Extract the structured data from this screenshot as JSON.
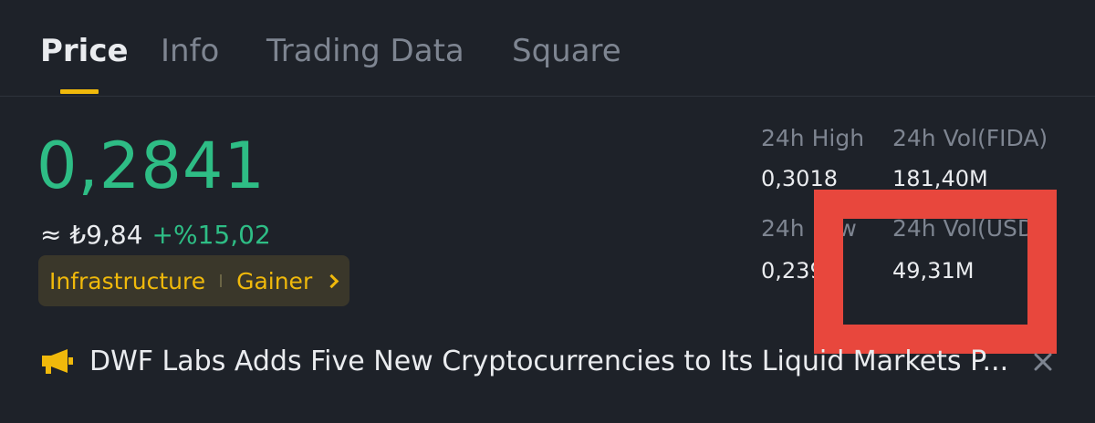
{
  "tabs": [
    {
      "label": "Price",
      "active": true
    },
    {
      "label": "Info",
      "active": false
    },
    {
      "label": "Trading Data",
      "active": false
    },
    {
      "label": "Square",
      "active": false
    }
  ],
  "price": {
    "last": "0,2841",
    "fiat": "≈ ₺9,84",
    "change": "+%15,02"
  },
  "tags": {
    "category": "Infrastructure",
    "status": "Gainer"
  },
  "stats": {
    "high_label": "24h High",
    "high_value": "0,3018",
    "vol_base_label": "24h Vol(FIDA)",
    "vol_base_value": "181,40M",
    "low_label": "24h Low",
    "low_value": "0,2395",
    "vol_quote_label": "24h Vol(USDT)",
    "vol_quote_value": "49,31M"
  },
  "news": {
    "icon": "megaphone-icon",
    "headline": "DWF Labs Adds Five New Cryptocurrencies to Its Liquid Markets P..."
  },
  "colors": {
    "background": "#1e2229",
    "positive": "#2ebd85",
    "accent": "#f0b90b",
    "annotation": "#e8473d"
  }
}
